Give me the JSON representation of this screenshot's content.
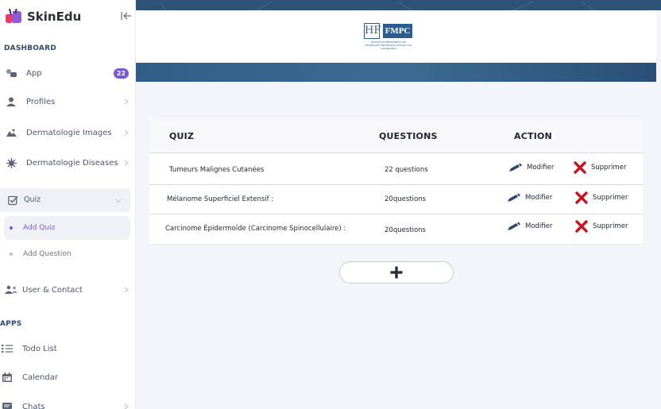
{
  "brand": {
    "name": "SkinEdu"
  },
  "sidebar": {
    "dashboard_title": "DASHBOARD",
    "apps_title": "APPS",
    "items": [
      {
        "label": "App",
        "icon": "app-icon",
        "badge": "22"
      },
      {
        "label": "Profiles",
        "icon": "user-icon"
      },
      {
        "label": "Dermatologie Images",
        "icon": "image-icon"
      },
      {
        "label": "Dermatologie Diseases",
        "icon": "virus-icon"
      },
      {
        "label": "Quiz",
        "icon": "checkbox-icon"
      },
      {
        "label": "User & Contact",
        "icon": "users-icon"
      },
      {
        "label": "Todo List",
        "icon": "list-icon"
      },
      {
        "label": "Calendar",
        "icon": "calendar-icon"
      },
      {
        "label": "Chats",
        "icon": "chat-icon"
      }
    ],
    "quiz_sub": [
      {
        "label": "Add Quiz",
        "active": true
      },
      {
        "label": "Add Question",
        "active": false
      }
    ]
  },
  "banner": {
    "logo_letters": "HF",
    "logo_text": "FMPC",
    "logo_caption": "FACULTÉ DE MÉDECINE ET DE PHARMACIE UNIVERSITÉ HASSAN II DE CASABLANCA"
  },
  "table": {
    "headers": {
      "quiz": "QUIZ",
      "questions": "QUESTIONS",
      "action": "ACTION"
    },
    "rows": [
      {
        "quiz": "Tumeurs Malignes Cutanées",
        "questions": "22 questions",
        "edit": "Modifier",
        "delete": "Supprimer"
      },
      {
        "quiz": "Mélanome Superficiel Extensif :",
        "questions": "20questions",
        "edit": "Modifier",
        "delete": "Supprimer"
      },
      {
        "quiz": "Carcinome Épidermoïde (Carcinome Spinocellulaire) :",
        "questions": "20questions",
        "edit": "Modifier",
        "delete": "Supprimer"
      }
    ]
  },
  "add_button": {
    "icon": "plus-icon"
  },
  "colors": {
    "accent": "#7b57d6",
    "banner": "#2e5278",
    "delete": "#c8141e",
    "edit": "#2d4a6b"
  }
}
